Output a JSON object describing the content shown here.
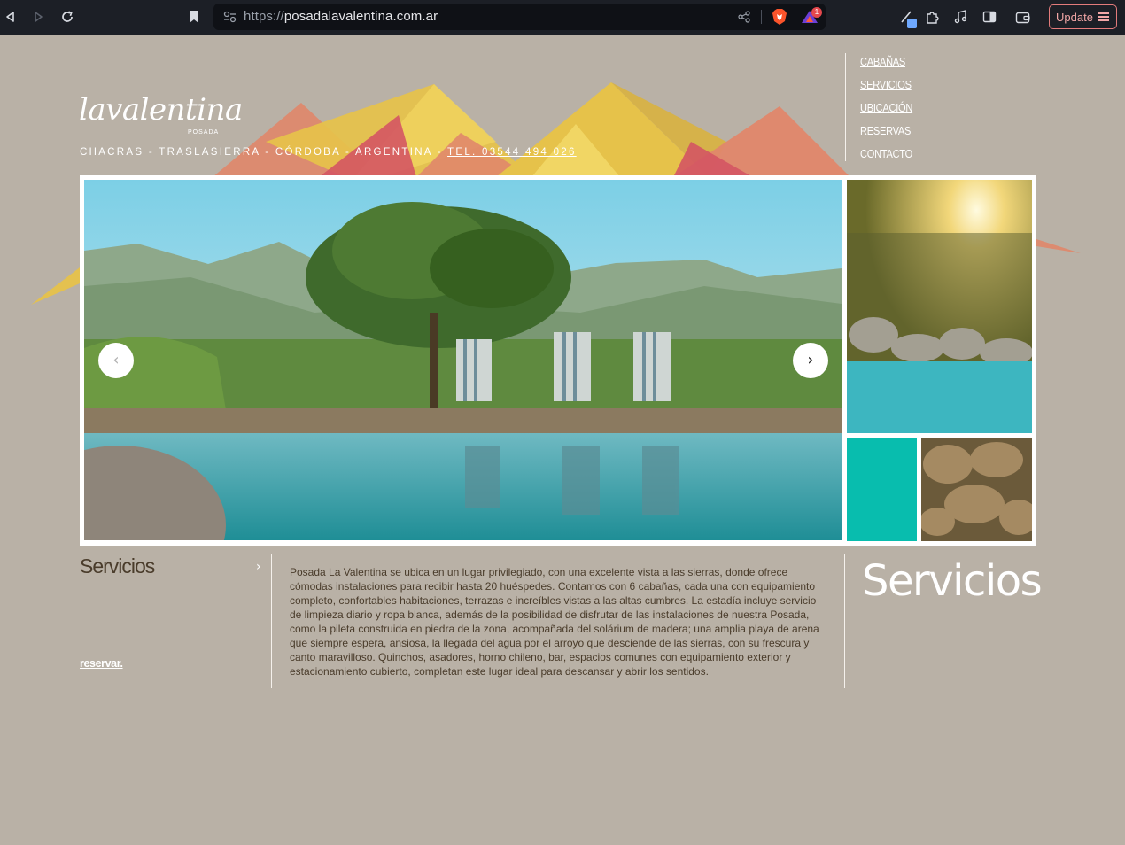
{
  "browser": {
    "url_scheme": "https://",
    "url_host": "posadalavalentina.com.ar",
    "update_label": "Update",
    "badge_count": "1"
  },
  "site": {
    "logo_text": "lavalentina",
    "logo_subtitle": "POSADA",
    "tagline_location": "CHACRAS - TRASLASIERRA - CÓRDOBA - ARGENTINA - ",
    "tagline_phone": "TEL. 03544 494 026"
  },
  "menu": {
    "items": [
      "CABAÑAS",
      "SERVICIOS",
      "UBICACIÓN",
      "RESERVAS",
      "CONTACTO"
    ]
  },
  "slider": {
    "prev_label": "‹",
    "next_label": "›"
  },
  "section": {
    "title": "Servicios",
    "chevron": "›",
    "reserve_label": "reservar.",
    "big_title": "Servicios",
    "body": "Posada La Valentina se ubica en un lugar privilegiado, con una excelente vista a las sierras, donde ofrece cómodas instalaciones para recibir hasta 20 huéspedes. Contamos con 6 cabañas, cada una con equipamiento completo, confortables habitaciones, terrazas e increíbles vistas a las altas cumbres. La estadía incluye servicio de limpieza diario y ropa blanca, además de la posibilidad de disfrutar de las instalaciones de nuestra Posada, como la pileta construida en piedra de la zona, acompañada del solárium de madera; una amplia playa de arena que siempre espera, ansiosa, la llegada del agua por el arroyo que desciende de las sierras, con su frescura y canto maravilloso. Quinchos, asadores, horno chileno, bar, espacios comunes con equipamiento exterior y estacionamiento cubierto, completan este lugar ideal para descansar y abrir los sentidos."
  },
  "colors": {
    "page_bg": "#b9b1a6",
    "accent_teal": "#08bdae",
    "text_brown": "#4a3c2b",
    "mountain_yellow": "#e6c24a",
    "mountain_coral": "#e0876a",
    "mountain_red": "#d45563"
  }
}
